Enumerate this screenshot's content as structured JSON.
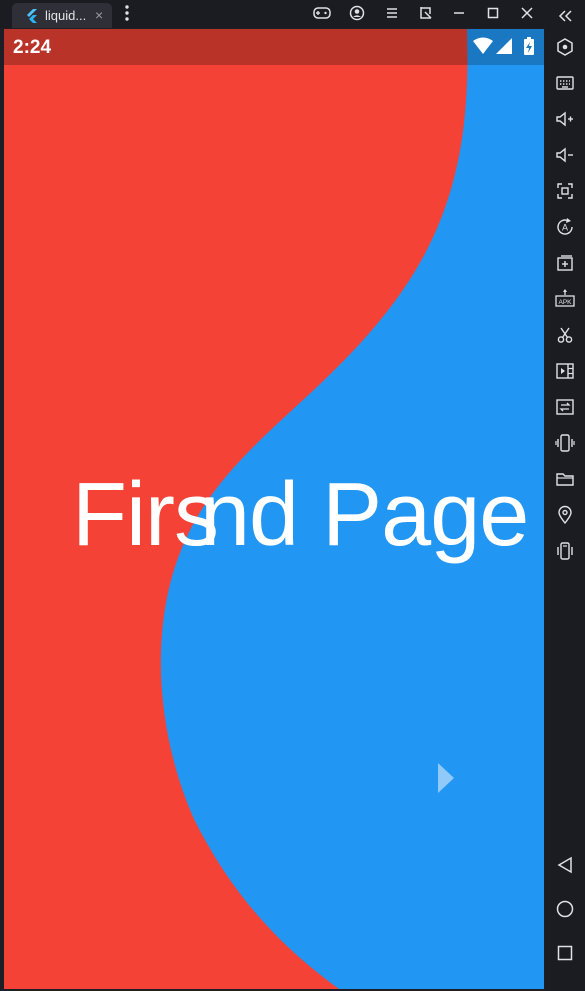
{
  "window": {
    "tab_title": "liquid...",
    "tab_close": "×",
    "icons": [
      "flutter-logo-icon",
      "more-vertical-icon",
      "gamepad-icon",
      "account-icon",
      "menu-icon",
      "screenshot-crop-icon",
      "minimize-icon",
      "maximize-icon",
      "close-icon",
      "collapse-sidebar-icon"
    ]
  },
  "statusbar": {
    "time": "2:24",
    "icons": [
      "wifi-icon",
      "cell-signal-icon",
      "battery-charging-icon"
    ]
  },
  "screen": {
    "overlay_text_a": "Firs",
    "overlay_text_b": "nd Page",
    "colors": {
      "red": "#f44336",
      "blue": "#2196f3",
      "status_red": "#ba3329",
      "status_blue": "#1a78c2"
    },
    "arrow_icon": "chevron-right-icon"
  },
  "sidebar": {
    "tools": [
      "settings-hex-icon",
      "keyboard-icon",
      "volume-up-icon",
      "volume-down-icon",
      "fullscreen-icon",
      "rotate-icon",
      "add-screen-icon",
      "apk-install-icon",
      "scissors-icon",
      "video-record-icon",
      "sync-icon",
      "shake-icon",
      "folder-icon",
      "location-icon",
      "vibrate-icon"
    ],
    "nav": [
      "back-icon",
      "home-icon",
      "recents-icon"
    ]
  }
}
